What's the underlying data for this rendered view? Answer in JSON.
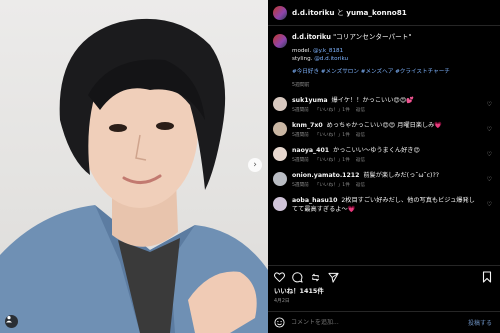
{
  "post": {
    "header_user1": "d.d.itoriku",
    "header_joiner": " と ",
    "header_user2": "yuma_konno81",
    "caption_user": "d.d.itoriku",
    "caption_title": "\"コリアンセンターパート\"",
    "credits_model_label": "model.",
    "credits_model_handle": "@y.k_8181",
    "credits_styling_label": "styling.",
    "credits_styling_handle": "@d.d.itoriku",
    "hashtags": "#今日好き #メンズサロン #メンズヘア #クライストチャーチ",
    "caption_time": "5週間前"
  },
  "comments": [
    {
      "user": "suk1yuma",
      "text": "爆イケ！！かっこいい😍😍💕",
      "time": "5週間前",
      "likes": "「いいね！」1件",
      "reply": "返信",
      "avatar_color": "#d8c9c0"
    },
    {
      "user": "knm_7x0",
      "text": "めっちゃかっこいい😍😍 月曜日楽しみ💗",
      "time": "5週間前",
      "likes": "「いいね！」1件",
      "reply": "返信",
      "avatar_color": "#c9b6a3"
    },
    {
      "user": "naoya_401",
      "text": "かっこいい〜ゆうまくん好き😍",
      "time": "5週間前",
      "likes": "「いいね！」1件",
      "reply": "返信",
      "avatar_color": "#e7d8cf"
    },
    {
      "user": "onion.yamato.1212",
      "text": "前髪が楽しみだ(っ˘ω˘c)??",
      "time": "5週間前",
      "likes": "「いいね！」1件",
      "reply": "返信",
      "avatar_color": "#b9bcc3"
    },
    {
      "user": "aoba_hasu10",
      "text": "2枚目すごい好みだし、他の写真もビジュ爆発してて最高すぎるよ〜💗",
      "time": "",
      "likes": "",
      "reply": "",
      "avatar_color": "#d0c4d8"
    }
  ],
  "actions": {
    "likes_text": "いいね！1415件",
    "date_text": "4月2日"
  },
  "comment_box": {
    "placeholder": "コメントを追加...",
    "post_label": "投稿する"
  },
  "icons": [
    "heart-icon",
    "comment-icon",
    "share-icon",
    "send-icon",
    "bookmark-icon",
    "emoji-icon",
    "tag-person-icon",
    "chevron-right-icon"
  ]
}
